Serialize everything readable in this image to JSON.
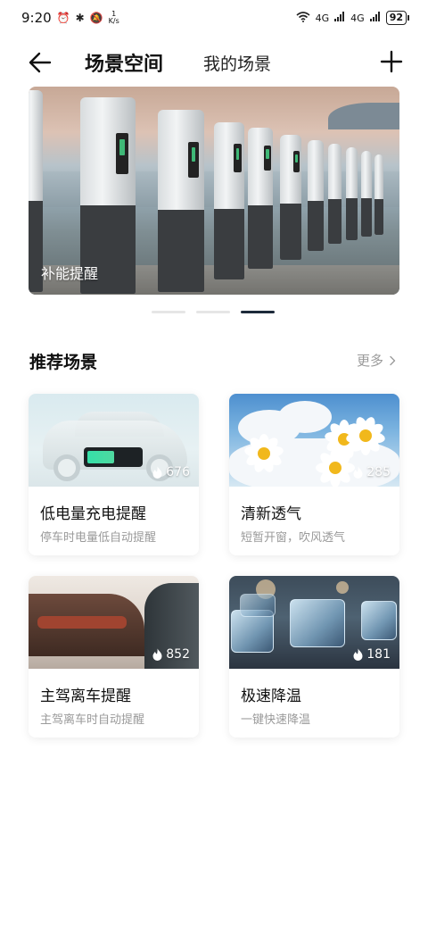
{
  "status_bar": {
    "time": "9:20",
    "speed": "1\nK/s",
    "network": "4G",
    "battery": "92"
  },
  "header": {
    "tab_active": "场景空间",
    "tab_inactive": "我的场景"
  },
  "banner": {
    "caption": "补能提醒",
    "page_count": 3,
    "active_page": 3
  },
  "section": {
    "title": "推荐场景",
    "more_label": "更多"
  },
  "cards": [
    {
      "title": "低电量充电提醒",
      "subtitle": "停车时电量低自动提醒",
      "count": "676",
      "image": "car-battery-image"
    },
    {
      "title": "清新透气",
      "subtitle": "短暂开窗，吹风透气",
      "count": "285",
      "image": "daisy-flowers-image"
    },
    {
      "title": "主驾离车提醒",
      "subtitle": "主驾离车时自动提醒",
      "count": "852",
      "image": "car-door-image"
    },
    {
      "title": "极速降温",
      "subtitle": "一键快速降温",
      "count": "181",
      "image": "ice-cubes-image"
    }
  ],
  "colors": {
    "accent_dark": "#1d2a3a",
    "muted_text": "#9a9a9a"
  }
}
